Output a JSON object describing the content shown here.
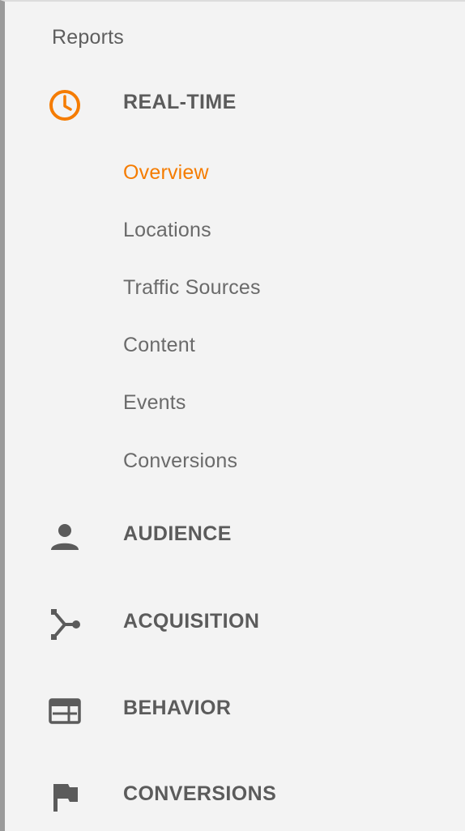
{
  "sidebar": {
    "heading": "Reports",
    "accent_color": "#f57c00",
    "sections": [
      {
        "label": "REAL-TIME",
        "icon": "clock-icon",
        "expanded": true,
        "items": [
          {
            "label": "Overview",
            "active": true
          },
          {
            "label": "Locations"
          },
          {
            "label": "Traffic Sources"
          },
          {
            "label": "Content"
          },
          {
            "label": "Events"
          },
          {
            "label": "Conversions"
          }
        ]
      },
      {
        "label": "AUDIENCE",
        "icon": "person-icon"
      },
      {
        "label": "ACQUISITION",
        "icon": "acquisition-icon"
      },
      {
        "label": "BEHAVIOR",
        "icon": "behavior-icon"
      },
      {
        "label": "CONVERSIONS",
        "icon": "flag-icon"
      }
    ]
  }
}
